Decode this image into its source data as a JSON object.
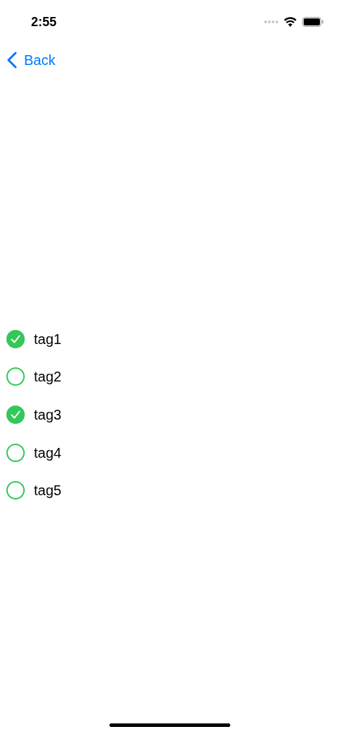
{
  "status_bar": {
    "time": "2:55"
  },
  "nav": {
    "back": "Back"
  },
  "tags": [
    {
      "label": "tag1",
      "checked": true
    },
    {
      "label": "tag2",
      "checked": false
    },
    {
      "label": "tag3",
      "checked": true
    },
    {
      "label": "tag4",
      "checked": false
    },
    {
      "label": "tag5",
      "checked": false
    }
  ]
}
